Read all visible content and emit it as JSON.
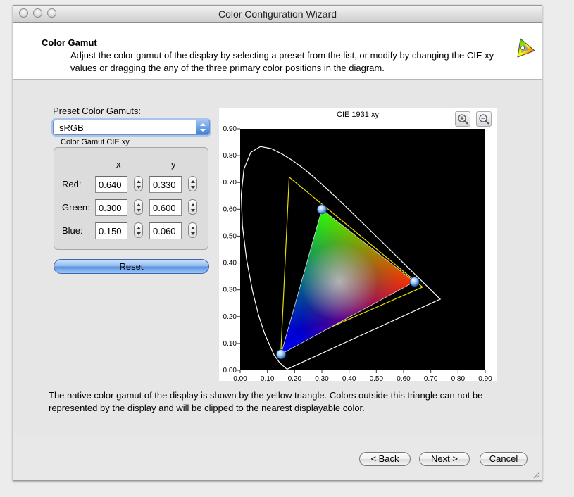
{
  "window": {
    "title": "Color Configuration Wizard"
  },
  "header": {
    "title": "Color Gamut",
    "description": "Adjust the color gamut of the display by selecting a preset from the list, or modify by changing the CIE xy values or dragging the any of the three primary color positions in the diagram.",
    "icon": "color-triangle-icon"
  },
  "preset": {
    "label": "Preset Color Gamuts:",
    "selected": "sRGB"
  },
  "gamut": {
    "group_label": "Color Gamut CIE xy",
    "col_x": "x",
    "col_y": "y",
    "rows": [
      {
        "label": "Red:",
        "x": "0.640",
        "y": "0.330"
      },
      {
        "label": "Green:",
        "x": "0.300",
        "y": "0.600"
      },
      {
        "label": "Blue:",
        "x": "0.150",
        "y": "0.060"
      }
    ],
    "reset_label": "Reset"
  },
  "chart_data": {
    "type": "scatter",
    "title": "CIE 1931 xy",
    "xlim": [
      0,
      0.9
    ],
    "ylim": [
      0,
      0.9
    ],
    "x_ticks": [
      "0.00",
      "0.10",
      "0.20",
      "0.30",
      "0.40",
      "0.50",
      "0.60",
      "0.70",
      "0.80",
      "0.90"
    ],
    "y_ticks": [
      "0.00",
      "0.10",
      "0.20",
      "0.30",
      "0.40",
      "0.50",
      "0.60",
      "0.70",
      "0.80",
      "0.90"
    ],
    "background": "#000000",
    "gamut_triangle": {
      "red": [
        0.64,
        0.33
      ],
      "green": [
        0.3,
        0.6
      ],
      "blue": [
        0.15,
        0.06
      ]
    },
    "native_triangle": {
      "color": "#e8e000",
      "points": [
        [
          0.18,
          0.72
        ],
        [
          0.67,
          0.31
        ],
        [
          0.15,
          0.08
        ]
      ]
    },
    "spectral_locus": [
      [
        0.1741,
        0.005
      ],
      [
        0.1738,
        0.0049
      ],
      [
        0.1733,
        0.0048
      ],
      [
        0.1726,
        0.0048
      ],
      [
        0.1714,
        0.0051
      ],
      [
        0.1689,
        0.0069
      ],
      [
        0.1644,
        0.0109
      ],
      [
        0.1566,
        0.0177
      ],
      [
        0.144,
        0.0297
      ],
      [
        0.1241,
        0.0578
      ],
      [
        0.0913,
        0.1327
      ],
      [
        0.0687,
        0.2007
      ],
      [
        0.0454,
        0.295
      ],
      [
        0.0235,
        0.4127
      ],
      [
        0.0082,
        0.5384
      ],
      [
        0.0039,
        0.6548
      ],
      [
        0.0139,
        0.7502
      ],
      [
        0.0389,
        0.812
      ],
      [
        0.0743,
        0.8338
      ],
      [
        0.1142,
        0.8262
      ],
      [
        0.1547,
        0.8059
      ],
      [
        0.1929,
        0.7816
      ],
      [
        0.2296,
        0.7543
      ],
      [
        0.2658,
        0.7243
      ],
      [
        0.3016,
        0.6923
      ],
      [
        0.3373,
        0.6589
      ],
      [
        0.3731,
        0.6245
      ],
      [
        0.4087,
        0.5896
      ],
      [
        0.4441,
        0.5547
      ],
      [
        0.4788,
        0.5202
      ],
      [
        0.5125,
        0.4866
      ],
      [
        0.5448,
        0.4544
      ],
      [
        0.5752,
        0.4242
      ],
      [
        0.6029,
        0.3965
      ],
      [
        0.627,
        0.3725
      ],
      [
        0.6482,
        0.3514
      ],
      [
        0.6658,
        0.334
      ],
      [
        0.6801,
        0.3197
      ],
      [
        0.6915,
        0.3083
      ],
      [
        0.7006,
        0.2993
      ],
      [
        0.7079,
        0.292
      ],
      [
        0.714,
        0.2859
      ],
      [
        0.719,
        0.2809
      ],
      [
        0.723,
        0.277
      ],
      [
        0.726,
        0.274
      ],
      [
        0.7283,
        0.2717
      ],
      [
        0.73,
        0.27
      ],
      [
        0.7347,
        0.2653
      ]
    ]
  },
  "zoom": {
    "in_icon": "zoom-in-icon",
    "out_icon": "zoom-out-icon"
  },
  "note": "The native color gamut of the display is shown by the yellow triangle. Colors outside this triangle can not be represented by the display and will be clipped to the nearest displayable color.",
  "buttons": {
    "back": "< Back",
    "next": "Next >",
    "cancel": "Cancel"
  }
}
